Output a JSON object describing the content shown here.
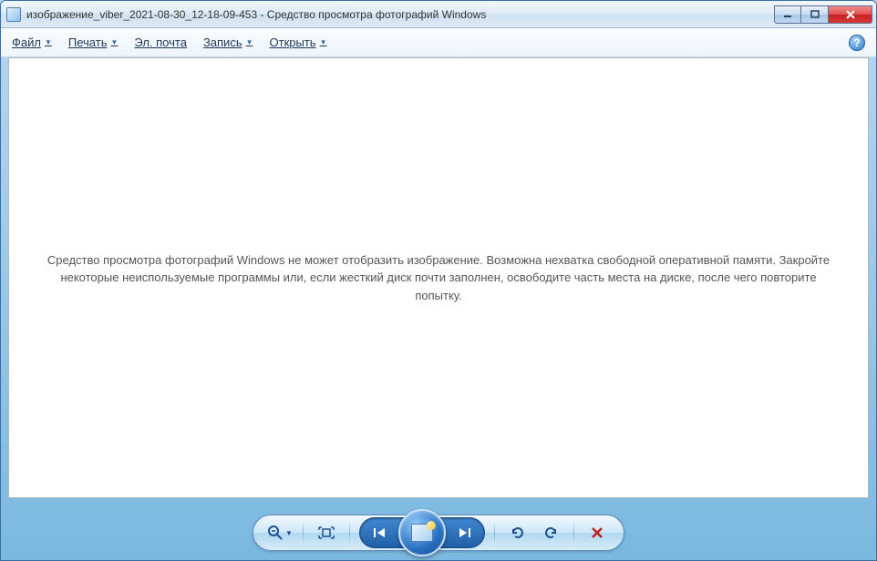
{
  "titlebar": {
    "title": "изображение_viber_2021-08-30_12-18-09-453 - Средство просмотра фотографий Windows"
  },
  "menu": {
    "file": "Файл",
    "print": "Печать",
    "email": "Эл. почта",
    "burn": "Запись",
    "open": "Открыть"
  },
  "viewer": {
    "error_message": "Средство просмотра фотографий Windows не может отобразить изображение. Возможна нехватка свободной оперативной памяти. Закройте некоторые неиспользуемые программы или, если жесткий диск почти заполнен, освободите часть места на диске, после чего повторите попытку."
  },
  "help": {
    "symbol": "?"
  }
}
